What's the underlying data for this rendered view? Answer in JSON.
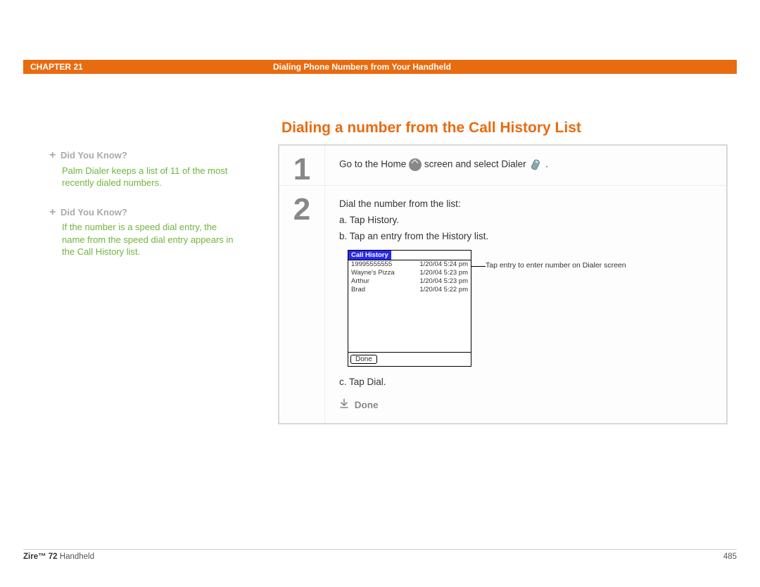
{
  "header": {
    "chapter": "CHAPTER 21",
    "title": "Dialing Phone Numbers from Your Handheld"
  },
  "main_title": "Dialing a number from the Call History List",
  "sidebar": {
    "items": [
      {
        "title": "Did You Know?",
        "body": "Palm Dialer keeps a list of 11 of the most recently dialed numbers."
      },
      {
        "title": "Did You Know?",
        "body": "If the number is a speed dial entry, the name from the speed dial entry appears in the Call History list."
      }
    ]
  },
  "steps": {
    "one": {
      "num": "1",
      "text_a": "Go to the Home ",
      "text_b": " screen and select Dialer ",
      "text_c": " ."
    },
    "two": {
      "num": "2",
      "intro": "Dial the number from the list:",
      "a": "a.  Tap History.",
      "b": "b.  Tap an entry from the History list.",
      "c": "c.  Tap Dial.",
      "done": "Done"
    }
  },
  "pda": {
    "title": "Call History",
    "entries": [
      {
        "name": "19995555555",
        "time": "1/20/04 5:24 pm"
      },
      {
        "name": "Wayne's Pizza",
        "time": "1/20/04 5:23 pm"
      },
      {
        "name": "Arthur",
        "time": "1/20/04 5:23 pm"
      },
      {
        "name": "Brad",
        "time": "1/20/04 5:22 pm"
      }
    ],
    "done_button": "Done",
    "callout": "Tap entry to enter number on Dialer screen"
  },
  "footer": {
    "product_bold": "Zire™ 72",
    "product_rest": " Handheld",
    "page": "485"
  }
}
